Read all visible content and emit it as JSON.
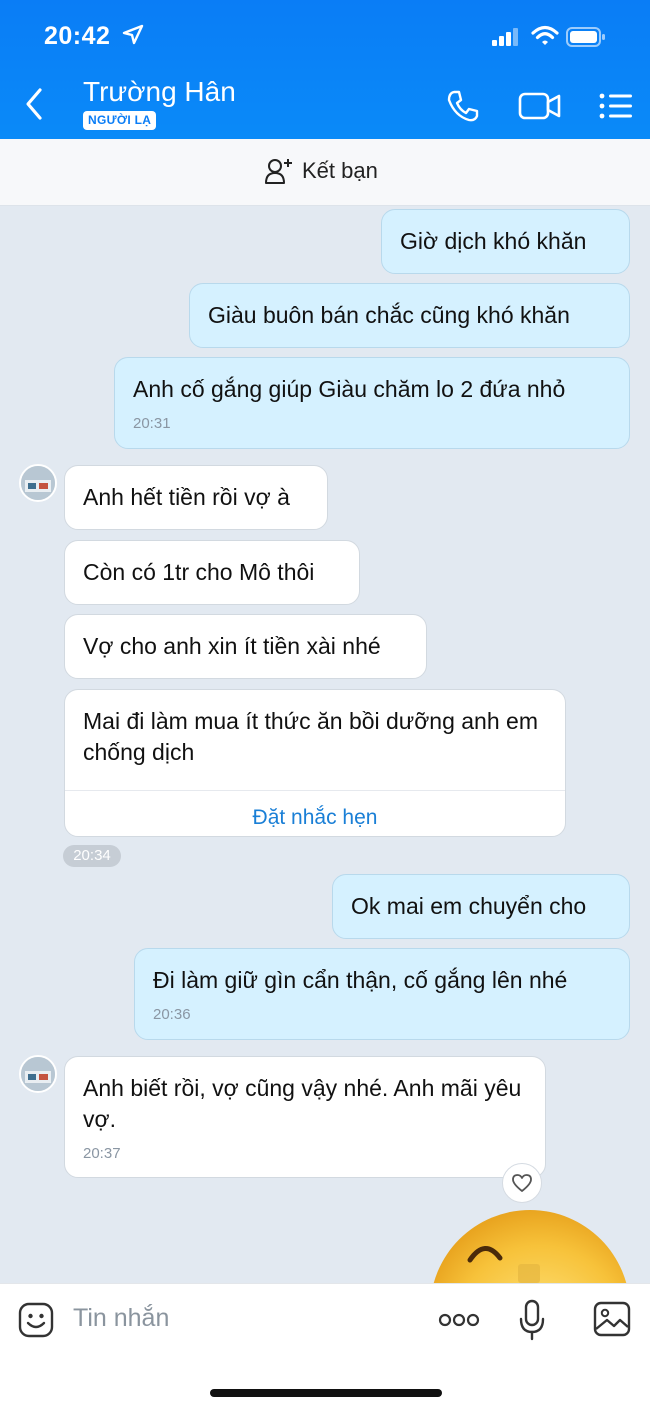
{
  "status": {
    "time": "20:42"
  },
  "header": {
    "contact_name": "Trường Hân",
    "badge": "NGƯỜI LẠ",
    "accent_color": "#0a7df6"
  },
  "friend_bar": {
    "label": "Kết bạn"
  },
  "messages": [
    {
      "direction": "out",
      "text": "Giờ dịch khó khăn"
    },
    {
      "direction": "out",
      "text": "Giàu buôn bán chắc cũng khó khăn"
    },
    {
      "direction": "out",
      "text": "Anh cố gắng giúp Giàu chăm lo 2 đứa nhỏ",
      "time": "20:31"
    },
    {
      "direction": "in",
      "text": "Anh hết tiền rồi vợ à"
    },
    {
      "direction": "in",
      "text": "Còn có 1tr cho Mô thôi"
    },
    {
      "direction": "in",
      "text": "Vợ cho anh xin ít tiền xài nhé"
    },
    {
      "direction": "in",
      "text": "Mai đi làm mua ít thức ăn bồi dưỡng anh em chống dịch",
      "action": "Đặt nhắc hẹn"
    },
    {
      "direction": "out",
      "text": "Ok mai em chuyển cho"
    },
    {
      "direction": "out",
      "text": "Đi làm giữ gìn cẩn thận, cố gắng lên nhé",
      "time": "20:36"
    },
    {
      "direction": "in",
      "text": "Anh biết rồi, vợ cũng vậy nhé. Anh mãi yêu vợ.",
      "time": "20:37"
    }
  ],
  "time_pill": "20:34",
  "composer": {
    "placeholder": "Tin nhắn"
  },
  "icons": [
    "location-arrow-icon",
    "signal-icon",
    "wifi-icon",
    "battery-icon",
    "back-icon",
    "phone-icon",
    "video-call-icon",
    "menu-icon",
    "add-friend-icon",
    "heart-icon",
    "emoji-icon",
    "more-icon",
    "microphone-icon",
    "image-icon"
  ]
}
